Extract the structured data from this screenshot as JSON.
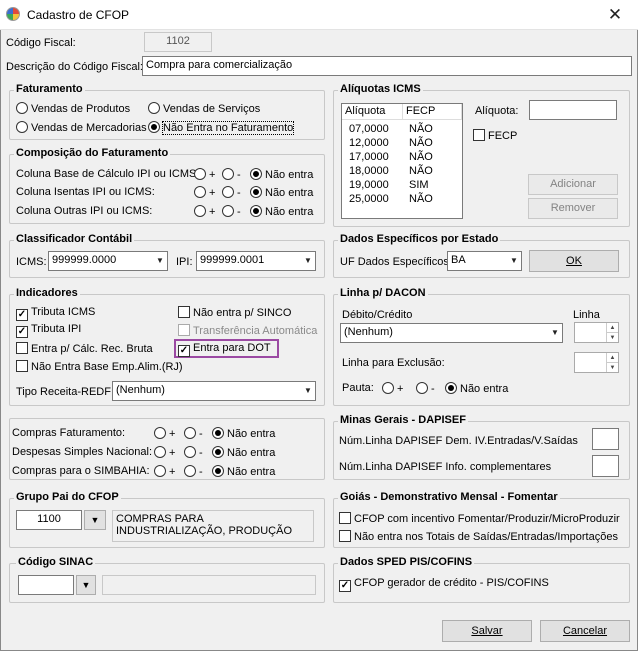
{
  "window": {
    "title": "Cadastro de CFOP",
    "close_glyph": "✕",
    "app_icon": "app-icon"
  },
  "codigo_fiscal": {
    "label": "Código Fiscal:",
    "value": "1102"
  },
  "descricao": {
    "label": "Descrição do Código Fiscal:",
    "value": "Compra para comercialização"
  },
  "faturamento": {
    "title": "Faturamento",
    "opt1": "Vendas de Produtos",
    "opt2": "Vendas de Serviços",
    "opt3": "Vendas de Mercadorias",
    "opt4": "Não Entra no Faturamento",
    "selected": "Não Entra no Faturamento"
  },
  "composicao": {
    "title": "Composição do Faturamento",
    "rows": [
      {
        "label": "Coluna Base de Cálculo IPI ou ICMS:",
        "plus": "+",
        "minus": "-",
        "none": "Não entra",
        "selected": "Não entra"
      },
      {
        "label": "Coluna Isentas IPI ou ICMS:",
        "plus": "+",
        "minus": "-",
        "none": "Não entra",
        "selected": "Não entra"
      },
      {
        "label": "Coluna Outras IPI ou ICMS:",
        "plus": "+",
        "minus": "-",
        "none": "Não entra",
        "selected": "Não entra"
      }
    ]
  },
  "classificador": {
    "title": "Classificador Contábil",
    "icms_label": "ICMS:",
    "icms_value": "999999.0000",
    "ipi_label": "IPI:",
    "ipi_value": "999999.0001"
  },
  "indicadores": {
    "title": "Indicadores",
    "tributa_icms": "Tributa ICMS",
    "tributa_icms_checked": true,
    "tributa_ipi": "Tributa IPI",
    "tributa_ipi_checked": true,
    "entra_calc": "Entra p/ Cálc. Rec. Bruta",
    "entra_calc_checked": false,
    "nao_entra_base": "Não Entra Base Emp.Alim.(RJ)",
    "nao_entra_base_checked": false,
    "nao_sinco": "Não entra p/ SINCO",
    "nao_sinco_checked": false,
    "transferencia": "Transferência Automática",
    "transferencia_checked": false,
    "entra_dot": "Entra para DOT",
    "entra_dot_checked": true,
    "tipo_receita_label": "Tipo Receita-REDF:",
    "tipo_receita_value": "(Nenhum)",
    "highlight_color": "#9b4aa3"
  },
  "compras": {
    "rows": [
      {
        "label": "Compras Faturamento:",
        "plus": "+",
        "minus": "-",
        "none": "Não entra",
        "selected": "Não entra"
      },
      {
        "label": "Despesas Simples Nacional:",
        "plus": "+",
        "minus": "-",
        "none": "Não entra",
        "selected": "Não entra"
      },
      {
        "label": "Compras para o SIMBAHIA:",
        "plus": "+",
        "minus": "-",
        "none": "Não entra",
        "selected": "Não entra"
      }
    ]
  },
  "grupo_pai": {
    "title": "Grupo Pai do CFOP",
    "code": "1100",
    "description": "COMPRAS PARA INDUSTRIALIZAÇÃO, PRODUÇÃO"
  },
  "sinac": {
    "title": "Código SINAC",
    "value": "",
    "description": ""
  },
  "aliquotas": {
    "title": "Alíquotas ICMS",
    "col1": "Alíquota",
    "col2": "FECP",
    "rows": [
      {
        "aliquota": "07,0000",
        "fecp": "NÃO"
      },
      {
        "aliquota": "12,0000",
        "fecp": "NÃO"
      },
      {
        "aliquota": "17,0000",
        "fecp": "NÃO"
      },
      {
        "aliquota": "18,0000",
        "fecp": "NÃO"
      },
      {
        "aliquota": "19,0000",
        "fecp": "SIM"
      },
      {
        "aliquota": "25,0000",
        "fecp": "NÃO"
      }
    ],
    "aliquota_label": "Alíquota:",
    "aliquota_value": "",
    "fecp_label": "FECP",
    "fecp_checked": false,
    "adicionar": "Adicionar",
    "remover": "Remover"
  },
  "dados_estado": {
    "title": "Dados Específicos por Estado",
    "uf_label": "UF Dados Específicos:",
    "uf_value": "BA",
    "ok": "OK"
  },
  "dacon": {
    "title": "Linha p/ DACON",
    "debito_label": "Débito/Crédito",
    "debito_value": "(Nenhum)",
    "linha_label": "Linha",
    "exclusao_label": "Linha para Exclusão:",
    "pauta_label": "Pauta:",
    "plus": "+",
    "minus": "-",
    "none": "Não entra",
    "selected": "Não entra"
  },
  "minas": {
    "title": "Minas Gerais - DAPISEF",
    "row1": "Núm.Linha DAPISEF Dem. IV.Entradas/V.Saídas",
    "row2": "Núm.Linha DAPISEF Info. complementares"
  },
  "goias": {
    "title": "Goiás - Demonstrativo Mensal - Fomentar",
    "opt1": "CFOP com incentivo  Fomentar/Produzir/MicroProduzir",
    "opt1_checked": false,
    "opt2": "Não entra nos Totais de  Saídas/Entradas/Importações",
    "opt2_checked": false
  },
  "sped": {
    "title": "Dados SPED PIS/COFINS",
    "opt1": "CFOP gerador de crédito - PIS/COFINS",
    "opt1_checked": true
  },
  "buttons": {
    "salvar": "Salvar",
    "cancelar": "Cancelar"
  }
}
